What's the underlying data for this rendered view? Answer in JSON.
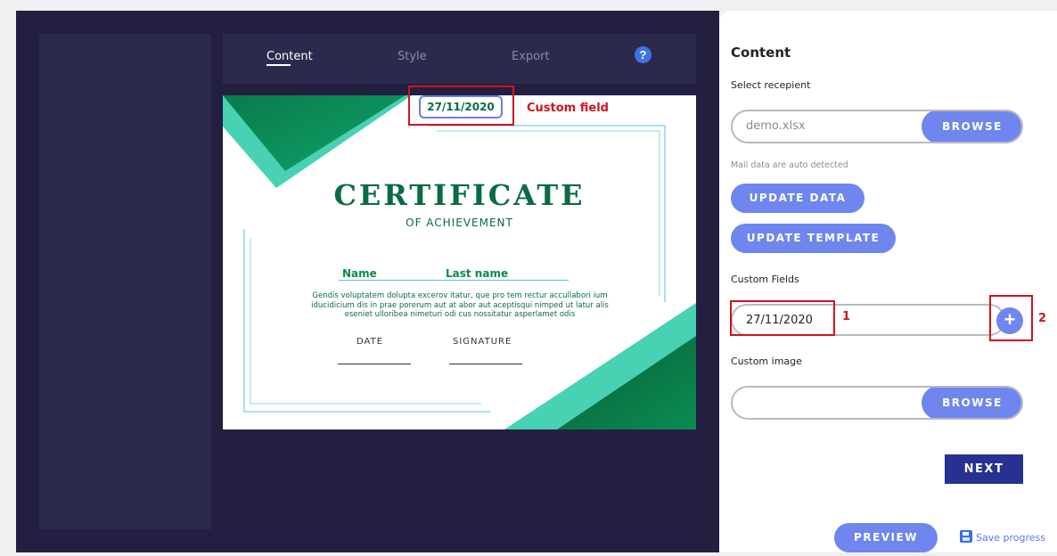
{
  "tabs": [
    {
      "label": "Content",
      "active": true
    },
    {
      "label": "Style",
      "active": false
    },
    {
      "label": "Export",
      "active": false
    }
  ],
  "help_icon": "?",
  "certificate": {
    "date_field": "27/11/2020",
    "title": "CERTIFICATE",
    "subtitle": "OF ACHIEVEMENT",
    "name": "Name",
    "last_name": "Last name",
    "body": "Gendis voluptatem dolupta excerov itatur, que pro tem rectur accullabori ium iducidicium dis in prae porerum aut at abor aut aceptisqui nimped ut latur alis eseniet ulloribea nimeturi odi cus nossitatur asperlamet odis",
    "date_label": "DATE",
    "signature_label": "SIGNATURE"
  },
  "annotations": {
    "custom_field_label": "Custom field",
    "marker_1": "1",
    "marker_2": "2"
  },
  "panel": {
    "title": "Content",
    "select_label": "Select recepient",
    "recipient_value": "demo.xlsx",
    "browse_label": "BROWSE",
    "hint": "Mail data are auto detected",
    "update_data": "UPDATE DATA",
    "update_template": "UPDATE TEMPLATE",
    "custom_fields_label": "Custom Fields",
    "custom_field_value": "27/11/2020",
    "add_icon": "+",
    "custom_image_label": "Custom image",
    "custom_image_value": "",
    "browse_label_2": "BROWSE",
    "next": "NEXT",
    "preview": "PREVIEW",
    "save_progress": "Save progress"
  },
  "colors": {
    "background_dark": "#221f40",
    "panel_dark": "#2c2a4c",
    "accent_blue": "#6f86ee",
    "next_blue": "#27318f",
    "cert_green": "#0a6b42",
    "cert_teal": "#48d1b3",
    "annotation_red": "#d0141f"
  }
}
